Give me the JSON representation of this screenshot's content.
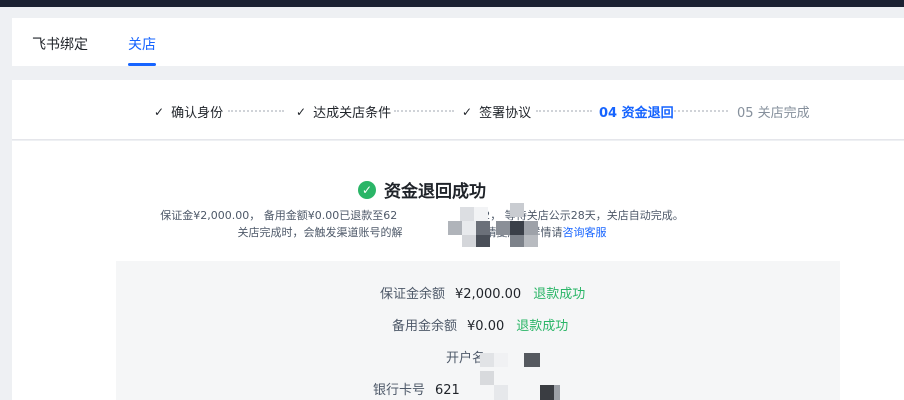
{
  "tabs": [
    {
      "label": "飞书绑定"
    },
    {
      "label": "关店"
    }
  ],
  "steps": [
    {
      "label": "确认身份",
      "state": "done"
    },
    {
      "label": "达成关店条件",
      "state": "done"
    },
    {
      "label": "签署协议",
      "state": "done"
    },
    {
      "label": "04 资金退回",
      "state": "current"
    },
    {
      "label": "05 关店完成",
      "state": "pending"
    }
  ],
  "result": {
    "title": "资金退回成功",
    "desc_line1_part1": "保证金¥2,000.00， 备用金额¥0.00已退款至62",
    "desc_line1_part2": "332， 等待关店公示28天，关店自动完成。",
    "desc_line2_part1": "关店完成时，会触发渠道账号的解",
    "desc_line2_part2": "申请复店，详情请",
    "desc_link": "咨询客服"
  },
  "details": {
    "deposit_label": "保证金余额",
    "deposit_value": "¥2,000.00",
    "deposit_status": "退款成功",
    "reserve_label": "备用金余额",
    "reserve_value": "¥0.00",
    "reserve_status": "退款成功",
    "account_label": "开户名",
    "card_label": "银行卡号",
    "card_value": "621"
  },
  "colors": {
    "accent": "#1664ff",
    "success": "#2ab567",
    "topbar": "#1c2233"
  }
}
